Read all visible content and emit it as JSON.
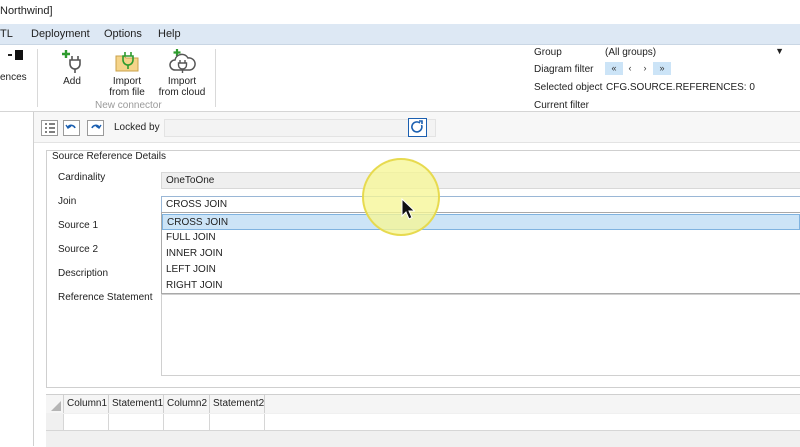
{
  "window": {
    "title": "Northwind]"
  },
  "menu": [
    "TL",
    "Deployment",
    "Options",
    "Help"
  ],
  "ribbon": {
    "references_label": "ences",
    "buttons": [
      {
        "label": "Add",
        "icon": "plug-add-icon"
      },
      {
        "label": "Import from file",
        "line1": "Import",
        "line2": "from file",
        "icon": "plug-folder-icon"
      },
      {
        "label": "Import from cloud",
        "line1": "Import",
        "line2": "from cloud",
        "icon": "plug-cloud-icon"
      }
    ],
    "group_caption": "New connector"
  },
  "properties": {
    "group_label": "Group",
    "group_value": "(All groups)",
    "diagram_filter_label": "Diagram filter",
    "nav": [
      "«",
      "‹",
      "›",
      "»"
    ],
    "selected_object_label": "Selected object",
    "selected_object_value": "CFG.SOURCE.REFERENCES: 0",
    "current_filter_label": "Current filter"
  },
  "toolbar": {
    "locked_by_label": "Locked by",
    "locked_by_value": ""
  },
  "details": {
    "title": "Source Reference Details",
    "labels": {
      "cardinality": "Cardinality",
      "join": "Join",
      "source1": "Source 1",
      "source2": "Source 2",
      "description": "Description",
      "reference_statement": "Reference Statement"
    },
    "cardinality_value": "OneToOne",
    "join_value": "CROSS JOIN",
    "join_options": [
      "CROSS JOIN",
      "FULL JOIN",
      "INNER JOIN",
      "LEFT JOIN",
      "RIGHT JOIN"
    ],
    "join_selected_index": 0
  },
  "grid": {
    "columns": [
      "Column1",
      "Statement1",
      "Column2",
      "Statement2"
    ]
  },
  "colors": {
    "menubar": "#dde8f4",
    "accent": "#0078d7",
    "selection": "#cce4f7",
    "highlight": "#f6f696"
  }
}
